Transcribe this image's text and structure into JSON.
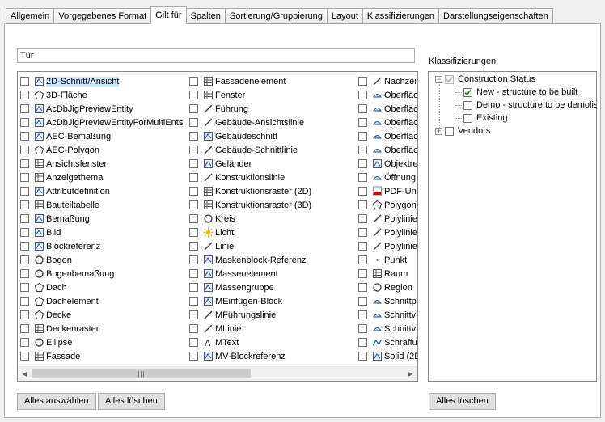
{
  "tabs": [
    "Allgemein",
    "Vorgegebenes Format",
    "Gilt für",
    "Spalten",
    "Sortierung/Gruppierung",
    "Layout",
    "Klassifizierungen",
    "Darstellungseigenschaften"
  ],
  "active_tab_index": 2,
  "search": {
    "value": "Tür"
  },
  "objects": {
    "col1": [
      "2D-Schnitt/Ansicht",
      "3D-Fläche",
      "AcDbJigPreviewEntity",
      "AcDbJigPreviewEntityForMultiEnts",
      "AEC-Bemaßung",
      "AEC-Polygon",
      "Ansichtsfenster",
      "Anzeigethema",
      "Attributdefinition",
      "Bauteiltabelle",
      "Bemaßung",
      "Bild",
      "Blockreferenz",
      "Bogen",
      "Bogenbemaßung",
      "Dach",
      "Dachelement",
      "Decke",
      "Deckenraster",
      "Ellipse",
      "Fassade"
    ],
    "col2": [
      "Fassadenelement",
      "Fenster",
      "Führung",
      "Gebäude-Ansichtslinie",
      "Gebäudeschnitt",
      "Gebäude-Schnittlinie",
      "Geländer",
      "Konstruktionslinie",
      "Konstruktionsraster (2D)",
      "Konstruktionsraster (3D)",
      "Kreis",
      "Licht",
      "Linie",
      "Maskenblock-Referenz",
      "Massenelement",
      "Massengruppe",
      "MEinfügen-Block",
      "MFührungslinie",
      "MLinie",
      "MText",
      "MV-Blockreferenz"
    ],
    "col3": [
      "Nachzei",
      "Oberfläc",
      "Oberfläc",
      "Oberfläc",
      "Oberfläc",
      "Oberfläc",
      "Objektre",
      "Öffnung",
      "PDF-Un",
      "Polygon",
      "Polylinie",
      "Polylinie",
      "Polylinie",
      "Punkt",
      "Raum",
      "Region",
      "Schnittp",
      "Schnittv",
      "Schnittv",
      "Schraffu",
      "Solid (2D"
    ]
  },
  "icons": {
    "col1": [
      "section-icon",
      "face3d-icon",
      "entity-icon",
      "entity-icon",
      "dimension-icon",
      "polygon-icon",
      "viewport-icon",
      "theme-icon",
      "attribute-icon",
      "table-icon",
      "dim-icon",
      "image-icon",
      "block-icon",
      "arc-icon",
      "arcdim-icon",
      "roof-icon",
      "roofslab-icon",
      "slab-icon",
      "grid-icon",
      "ellipse-icon",
      "curtainwall-icon"
    ],
    "col2": [
      "curtainunit-icon",
      "window-icon",
      "leader-icon",
      "elevline-icon",
      "bldgsection-icon",
      "sectionline-icon",
      "railing-icon",
      "xline-icon",
      "grid2d-icon",
      "grid3d-icon",
      "circle-icon",
      "light-icon",
      "line-icon",
      "maskblock-icon",
      "massel-icon",
      "massgroup-icon",
      "minsert-icon",
      "mleader-icon",
      "mline-icon",
      "mtext-icon",
      "mvblock-icon"
    ],
    "col3": [
      "trace-icon",
      "surface-icon",
      "surface-icon",
      "surface-icon",
      "surface-icon",
      "surface-icon",
      "objref-icon",
      "opening-icon",
      "pdf-icon",
      "polygon-icon",
      "polyline-icon",
      "polyline-icon",
      "polyline-icon",
      "point-icon",
      "space-icon",
      "region-icon",
      "sectionplane-icon",
      "sectionview-icon",
      "sectionview-icon",
      "hatch-icon",
      "solid2d-icon"
    ]
  },
  "classifications": {
    "label": "Klassifizierungen:",
    "tree": [
      {
        "label": "Construction Status",
        "children": [
          {
            "label": "New - structure to be built",
            "checked": true
          },
          {
            "label": "Demo - structure to be demolis",
            "checked": false
          },
          {
            "label": "Existing",
            "checked": false
          }
        ]
      },
      {
        "label": "Vendors",
        "children": []
      }
    ]
  },
  "buttons": {
    "select_all": "Alles auswählen",
    "clear_all": "Alles löschen",
    "clear_all_class": "Alles löschen"
  },
  "colors": {
    "selection": "#cce8ff",
    "checkmark": "#2a8a2a"
  }
}
